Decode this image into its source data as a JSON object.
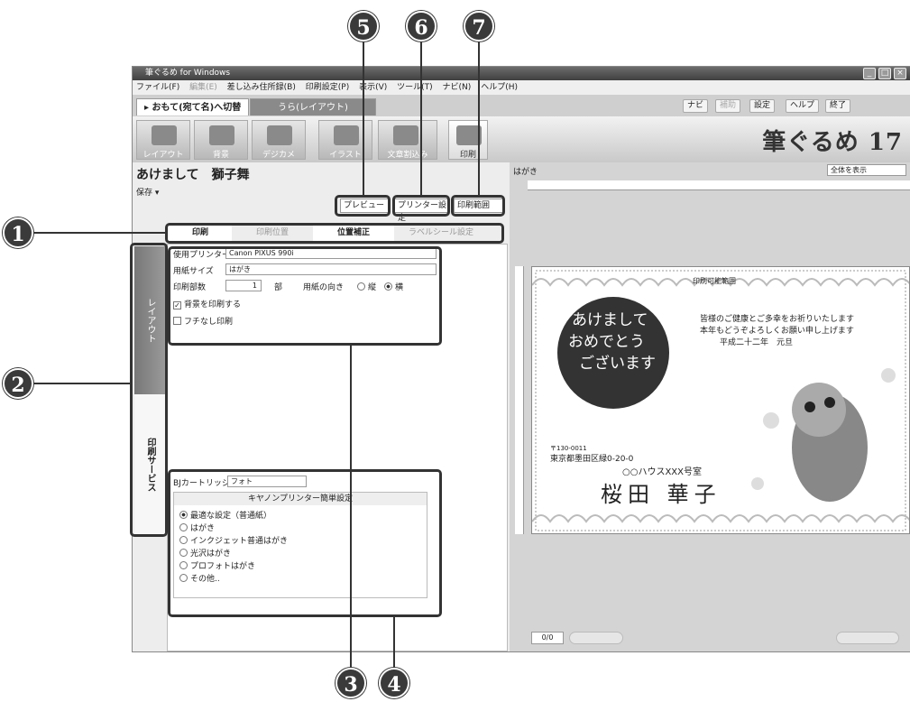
{
  "window": {
    "title": "筆ぐるめ for Windows",
    "brand": "筆ぐるめ 17"
  },
  "menu": [
    "ファイル(F)",
    "編集(E)",
    "差し込み住所録(B)",
    "印刷設定(P)",
    "表示(V)",
    "ツール(T)",
    "ナビ(N)",
    "ヘルプ(H)"
  ],
  "tabs": {
    "omote": "▸ おもて(宛て名)へ切替",
    "ura": "うら(レイアウト)"
  },
  "toolbar_right": [
    "ナビ",
    "補助",
    "設定",
    "ヘルプ",
    "終了"
  ],
  "modes": [
    "レイアウト",
    "背景",
    "デジカメ",
    "イラスト",
    "文章割込み",
    "印刷"
  ],
  "doc": {
    "title": "あけまして　獅子舞",
    "save": "保存 ▾"
  },
  "actions": {
    "preview": "プレビュー",
    "printer_setup": "プリンター設定",
    "print_area": "印刷範囲"
  },
  "print_tabs": [
    "印刷",
    "印刷位置",
    "位置補正",
    "ラベルシール設定"
  ],
  "side_tabs": {
    "layout": "レイアウト",
    "print_service": "印刷サービス"
  },
  "settings": {
    "printer_label": "使用プリンター",
    "printer_value": "Canon PIXUS 990i",
    "paper_label": "用紙サイズ",
    "paper_value": "はがき",
    "copies_label": "印刷部数",
    "copies_value": "1",
    "copies_unit": "部",
    "orient_label": "用紙の向き",
    "orient_v": "縦",
    "orient_h": "横",
    "bg_print": "背景を印刷する",
    "borderless": "フチなし印刷"
  },
  "cartridge": {
    "label": "BJカートリッジ",
    "value": "フォト",
    "header": "キヤノンプリンター簡単設定",
    "options": [
      "最適な設定（普通紙）",
      "はがき",
      "インクジェット普通はがき",
      "光沢はがき",
      "プロフォトはがき",
      "その他.."
    ]
  },
  "preview": {
    "paper": "はがき",
    "zoom": "全体を表示",
    "page": "0/0",
    "printable": "印刷可能範囲",
    "greeting": [
      "あけまして",
      "おめでとう",
      "ございます"
    ],
    "message": [
      "皆様のご健康とご多幸をお祈りいたします",
      "本年もどうぞよろしくお願い申し上げます",
      "平成二十二年　元旦"
    ],
    "postal": "〒130-0011",
    "address": "東京都墨田区緑0-20-0",
    "building": "○○ハウスXXX号室",
    "name": "桜田 華子"
  },
  "callouts": [
    "1",
    "2",
    "3",
    "4",
    "5",
    "6",
    "7"
  ]
}
